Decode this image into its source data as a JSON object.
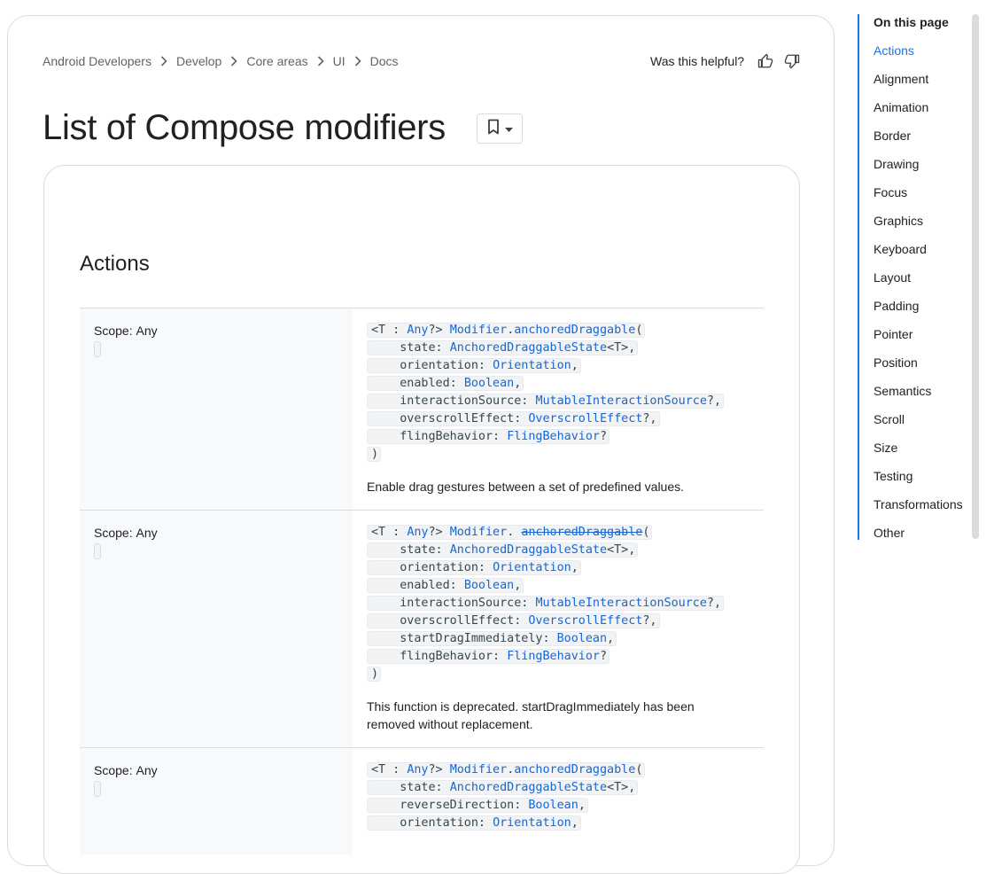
{
  "breadcrumb": [
    "Android Developers",
    "Develop",
    "Core areas",
    "UI",
    "Docs"
  ],
  "helpful": {
    "label": "Was this helpful?"
  },
  "page_title": "List of Compose modifiers",
  "section": {
    "heading": "Actions"
  },
  "rows": [
    {
      "scope_label": "Scope:",
      "scope_value": "Any",
      "code": {
        "l1_a": "<T : ",
        "l1_b": "Any",
        "l1_c": "?> ",
        "l1_d": "Modifier",
        "l1_e": ".",
        "l1_f": "anchoredDraggable",
        "l1_g": "(",
        "l2_a": "    state: ",
        "l2_b": "AnchoredDraggableState",
        "l2_c": "<T>,",
        "l3_a": "    orientation: ",
        "l3_b": "Orientation",
        "l3_c": ",",
        "l4_a": "    enabled: ",
        "l4_b": "Boolean",
        "l4_c": ",",
        "l5_a": "    interactionSource: ",
        "l5_b": "MutableInteractionSource",
        "l5_c": "?,",
        "l6_a": "    overscrollEffect: ",
        "l6_b": "OverscrollEffect",
        "l6_c": "?,",
        "l7_a": "    flingBehavior: ",
        "l7_b": "FlingBehavior",
        "l7_c": "?",
        "l8": ")"
      },
      "description": "Enable drag gestures between a set of predefined values."
    },
    {
      "scope_label": "Scope:",
      "scope_value": "Any",
      "code": {
        "l1_a": "<T : ",
        "l1_b": "Any",
        "l1_c": "?> ",
        "l1_d": "Modifier",
        "l1_e": ". ",
        "l1_f": "anchoredDraggable",
        "l1_g": "(",
        "l2_a": "    state: ",
        "l2_b": "AnchoredDraggableState",
        "l2_c": "<T>,",
        "l3_a": "    orientation: ",
        "l3_b": "Orientation",
        "l3_c": ",",
        "l4_a": "    enabled: ",
        "l4_b": "Boolean",
        "l4_c": ",",
        "l5_a": "    interactionSource: ",
        "l5_b": "MutableInteractionSource",
        "l5_c": "?,",
        "l6_a": "    overscrollEffect: ",
        "l6_b": "OverscrollEffect",
        "l6_c": "?,",
        "l7_a": "    startDragImmediately: ",
        "l7_b": "Boolean",
        "l7_c": ",",
        "l8_a": "    flingBehavior: ",
        "l8_b": "FlingBehavior",
        "l8_c": "?",
        "l9": ")"
      },
      "deprecated_bold": "This function is deprecated.",
      "deprecated_rest": " startDragImmediately has been removed without replacement."
    },
    {
      "scope_label": "Scope:",
      "scope_value": "Any",
      "code": {
        "l1_a": "<T : ",
        "l1_b": "Any",
        "l1_c": "?> ",
        "l1_d": "Modifier",
        "l1_e": ".",
        "l1_f": "anchoredDraggable",
        "l1_g": "(",
        "l2_a": "    state: ",
        "l2_b": "AnchoredDraggableState",
        "l2_c": "<T>,",
        "l3_a": "    reverseDirection: ",
        "l3_b": "Boolean",
        "l3_c": ",",
        "l4_a": "    orientation: ",
        "l4_b": "Orientation",
        "l4_c": ","
      }
    }
  ],
  "toc": {
    "title": "On this page",
    "items": [
      "Actions",
      "Alignment",
      "Animation",
      "Border",
      "Drawing",
      "Focus",
      "Graphics",
      "Keyboard",
      "Layout",
      "Padding",
      "Pointer",
      "Position",
      "Semantics",
      "Scroll",
      "Size",
      "Testing",
      "Transformations",
      "Other"
    ]
  },
  "colors": {
    "link": "#1967d2",
    "accent": "#1a73e8",
    "border": "#dadce0",
    "left_col_bg": "#f8f9fa"
  },
  "icons": [
    "chevron-right-icon",
    "thumb-up-icon",
    "thumb-down-icon",
    "bookmark-icon",
    "caret-down-icon"
  ]
}
